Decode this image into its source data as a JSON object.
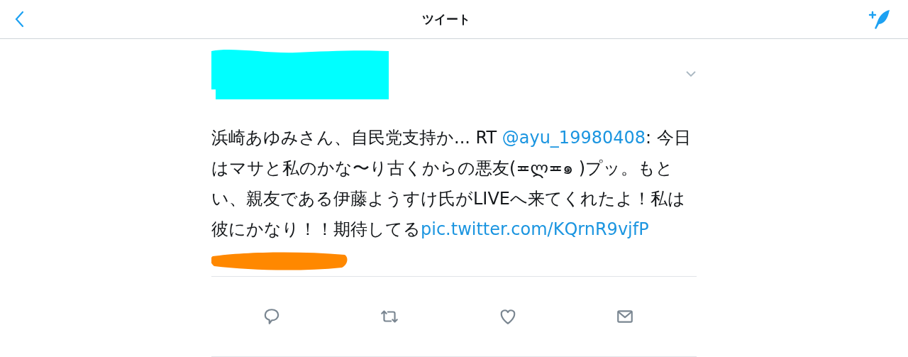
{
  "nav_bar": {
    "title": "ツイート"
  },
  "tweet": {
    "intro": "浜崎あゆみさん、自民党支持か... RT ",
    "mention": "@ayu_19980408",
    "body": ": 今日はマサと私のかな〜り古くからの悪友(≖ლ≖๑ )プッ。もとい、親友である伊藤ようすけ氏がLIVEへ来てくれたよ！私は彼にかなり！！期待してる",
    "link": "pic.twitter.com/KQrnR9vjfP"
  },
  "actions": [
    {
      "kind": "reply"
    },
    {
      "kind": "retweet"
    },
    {
      "kind": "like"
    },
    {
      "kind": "message"
    }
  ]
}
